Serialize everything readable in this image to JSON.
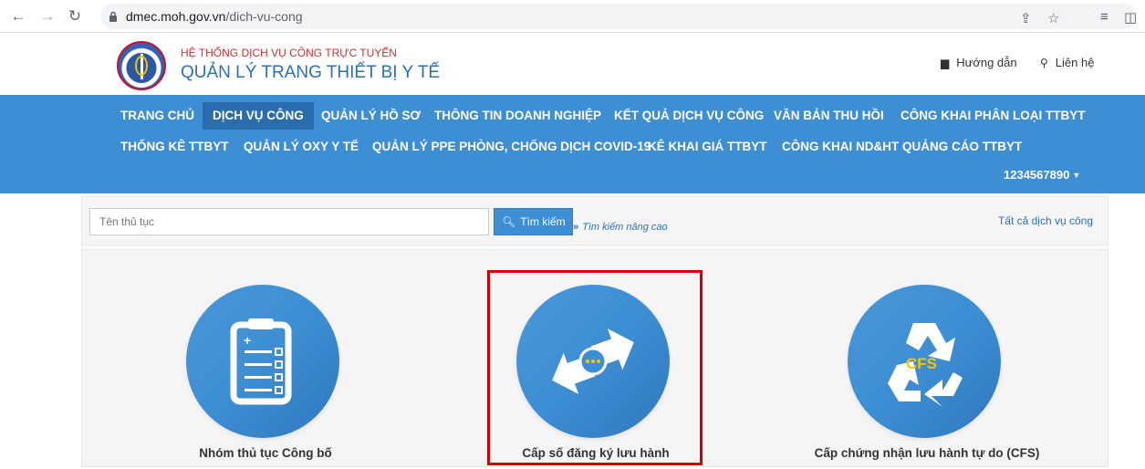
{
  "browser": {
    "url_domain": "dmec.moh.gov.vn",
    "url_path": "/dich-vu-cong"
  },
  "header": {
    "system_label": "HỆ THỐNG DỊCH VỤ CÔNG TRỰC TUYẾN",
    "system_name": "QUẢN LÝ TRANG THIẾT BỊ Y TẾ",
    "logo_text_top": "BỘ Y TẾ",
    "logo_text_bottom": "MINISTRY OF HEALTH",
    "guide_link": "Hướng dẫn",
    "contact_link": "Liên hệ"
  },
  "nav": {
    "items": [
      "TRANG CHỦ",
      "DỊCH VỤ CÔNG",
      "QUẢN LÝ HỒ SƠ",
      "THÔNG TIN DOANH NGHIỆP",
      "KẾT QUẢ DỊCH VỤ CÔNG",
      "VĂN BẢN THU HỒI",
      "CÔNG KHAI PHÂN LOẠI TTBYT",
      "THỐNG KÊ TTBYT",
      "QUẢN LÝ OXY Y TẾ",
      "QUẢN LÝ PPE PHÒNG, CHỐNG DỊCH COVID-19",
      "KÊ KHAI GIÁ TTBYT",
      "CÔNG KHAI ND&HT QUẢNG CÁO TTBYT"
    ],
    "active_item": "DỊCH VỤ CÔNG",
    "user": "1234567890"
  },
  "search": {
    "placeholder": "Tên thủ tục",
    "button_label": "Tìm kiếm",
    "advanced_label": "Tìm kiếm nâng cao",
    "all_services_label": "Tất cả dịch vụ công"
  },
  "cards": [
    {
      "label": "Nhóm thủ tục Công bố",
      "icon": "clipboard-list-icon"
    },
    {
      "label": "Cấp số đăng ký lưu hành",
      "icon": "refresh-chat-icon",
      "highlighted": true
    },
    {
      "label": "Cấp chứng nhận lưu hành tự do (CFS)",
      "icon": "recycle-cfs-icon",
      "badge": "CFS"
    }
  ],
  "colors": {
    "nav_bg": "#3e8ed3",
    "nav_active": "#2a6daf",
    "highlight": "#d40000",
    "brand_red": "#d32f2f",
    "brand_blue": "#2c6fb7"
  }
}
